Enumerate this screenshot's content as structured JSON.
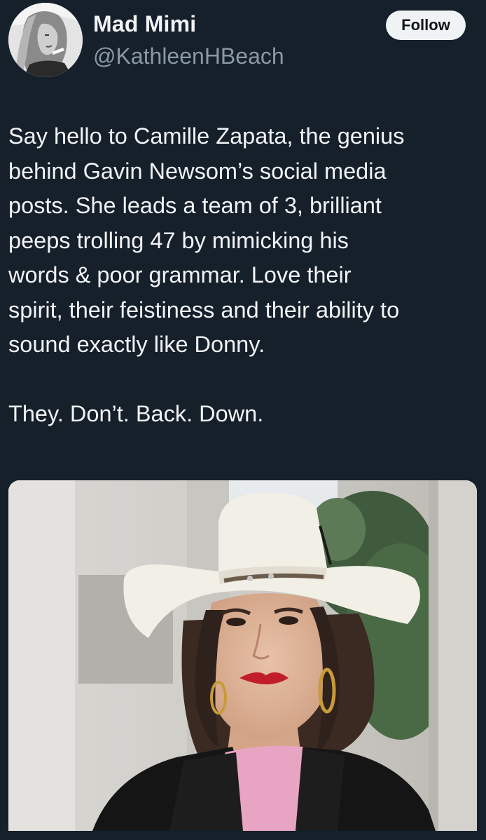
{
  "author": {
    "display_name": "Mad Mimi",
    "handle": "@KathleenHBeach",
    "avatar_icon": "profile-photo-avatar"
  },
  "actions": {
    "follow_label": "Follow"
  },
  "tweet": {
    "paragraphs": [
      "Say hello to Camille Zapata, the genius\nbehind Gavin Newsom’s social media\nposts. She leads a team of 3, brilliant\npeeps trolling 47 by mimicking his\nwords & poor grammar. Love their\nspirit, their feistiness and their ability to\nsound exactly like Donny.",
      "They. Don’t. Back. Down."
    ]
  },
  "media": {
    "type": "photo",
    "subject": "woman-in-white-cowboy-hat-photo"
  },
  "colors": {
    "background": "#15202b",
    "text": "#e7e9ea",
    "secondary_text": "#8b98a5",
    "button_bg": "#eff3f4",
    "button_text": "#0f1419"
  }
}
